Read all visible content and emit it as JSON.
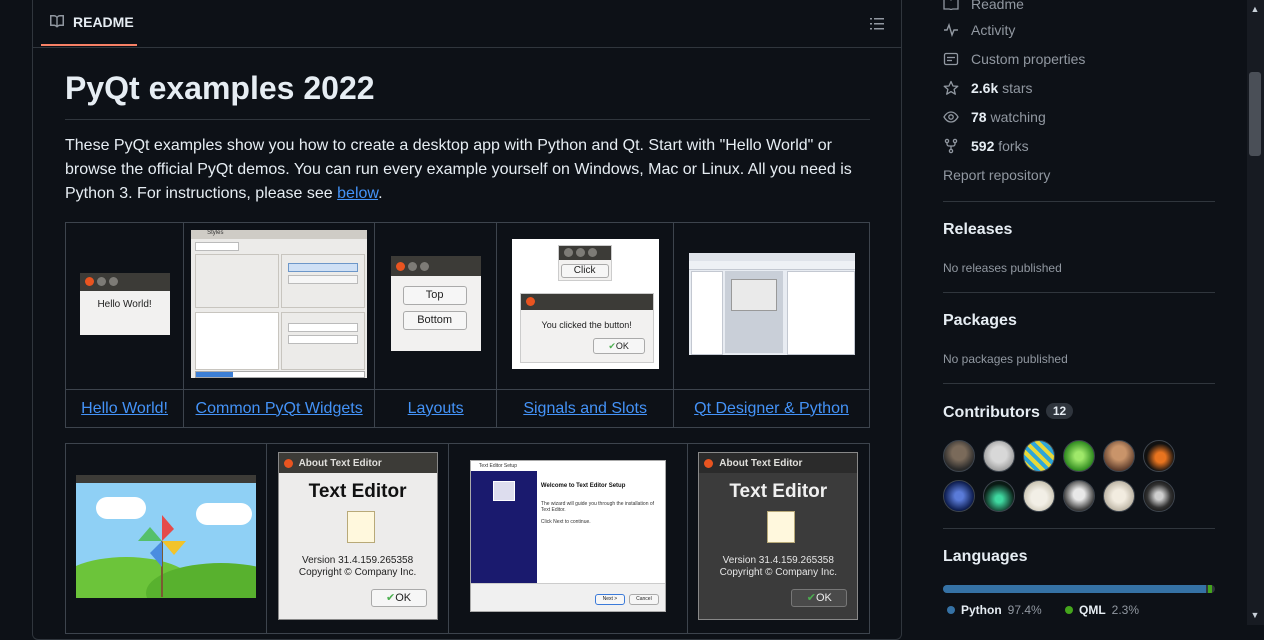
{
  "readme": {
    "tab_label": "README",
    "title": "PyQt examples 2022",
    "intro_text": "These PyQt examples show you how to create a desktop app with Python and Qt. Start with \"Hello World\" or browse the official PyQt demos. You can run every example yourself on Windows, Mac or Linux. All you need is Python 3. For instructions, please see ",
    "intro_link": "below",
    "intro_end": "."
  },
  "gallery_row1": [
    {
      "caption": "Hello World!",
      "thumb_text": "Hello World!"
    },
    {
      "caption": "Common PyQt Widgets",
      "thumb_title": "Styles"
    },
    {
      "caption": "Layouts",
      "btn_top": "Top",
      "btn_bottom": "Bottom"
    },
    {
      "caption": "Signals and Slots",
      "btn_click": "Click",
      "msg": "You clicked the button!",
      "ok": "OK"
    },
    {
      "caption": "Qt Designer & Python"
    }
  ],
  "gallery_row2": [
    {
      "kind": "pinwheel"
    },
    {
      "dialog_title": "About Text Editor",
      "heading": "Text Editor",
      "version": "Version 31.4.159.265358",
      "copyright": "Copyright © Company Inc.",
      "ok": "OK"
    },
    {
      "window_title": "Text Editor Setup",
      "heading": "Welcome to Text Editor Setup",
      "body": "The wizard will guide you through the installation of Text Editor.",
      "click": "Click Next to continue.",
      "next": "Next >",
      "cancel": "Cancel"
    },
    {
      "dialog_title": "About Text Editor",
      "heading": "Text Editor",
      "version": "Version 31.4.159.265358",
      "copyright": "Copyright © Company Inc.",
      "ok": "OK"
    }
  ],
  "sidebar": {
    "links": {
      "readme": "Readme",
      "activity": "Activity",
      "custom_properties": "Custom properties",
      "stars_count": "2.6k",
      "stars_label": "stars",
      "watching_count": "78",
      "watching_label": "watching",
      "forks_count": "592",
      "forks_label": "forks",
      "report": "Report repository"
    },
    "releases": {
      "heading": "Releases",
      "empty": "No releases published"
    },
    "packages": {
      "heading": "Packages",
      "empty": "No packages published"
    },
    "contributors": {
      "heading": "Contributors",
      "count": "12"
    },
    "languages": {
      "heading": "Languages",
      "items": [
        {
          "name": "Python",
          "percent": "97.4%",
          "fraction": 0.974,
          "color": "#3572A5"
        },
        {
          "name": "QML",
          "percent": "2.3%",
          "fraction": 0.023,
          "color": "#44a51c"
        }
      ]
    }
  }
}
